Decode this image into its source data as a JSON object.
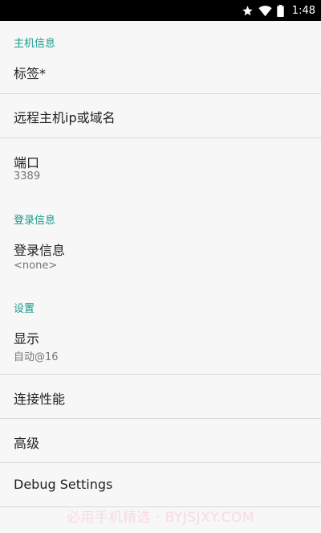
{
  "status_bar": {
    "time": "1:48",
    "icons": [
      "star-icon",
      "wifi-icon",
      "battery-icon"
    ]
  },
  "sections": {
    "host_info": {
      "header": "主机信息",
      "label": {
        "title": "标签*"
      },
      "remote_host": {
        "title": "远程主机ip或域名"
      },
      "port": {
        "title": "端口",
        "summary": "3389"
      }
    },
    "login_info": {
      "header": "登录信息",
      "credentials": {
        "title": "登录信息",
        "summary": "<none>"
      }
    },
    "settings": {
      "header": "设置",
      "display": {
        "title": "显示",
        "summary": "自动@16"
      },
      "connection_performance": {
        "title": "连接性能"
      },
      "advanced": {
        "title": "高级"
      },
      "debug": {
        "title": "Debug Settings"
      }
    }
  },
  "watermark": "必用手机精选 · BYJSJXY.COM",
  "colors": {
    "accent": "#1a9a8c",
    "background": "#f7f7f7",
    "status_bar": "#000000",
    "divider": "#d9d9d9"
  }
}
